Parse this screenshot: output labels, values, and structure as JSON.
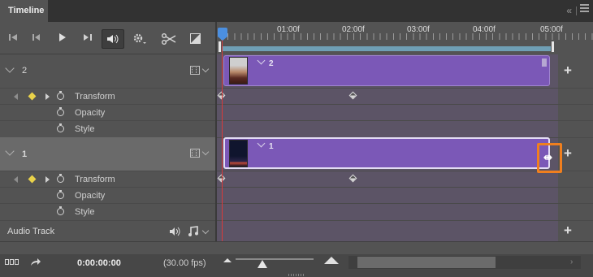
{
  "panel": {
    "tab_title": "Timeline",
    "collapse_glyph": "«",
    "menu_icon": "hamburger-menu-icon"
  },
  "transport": {
    "buttons": [
      "go-to-first-frame-icon",
      "previous-frame-icon",
      "play-icon",
      "next-frame-icon",
      "mute-audio-icon",
      "settings-icon",
      "split-at-playhead-icon",
      "transition-icon"
    ]
  },
  "ruler": {
    "labels": [
      "01:00f",
      "02:00f",
      "03:00f",
      "04:00f",
      "05:00f"
    ]
  },
  "tracks": [
    {
      "name": "2",
      "clip_name": "2",
      "properties": [
        "Transform",
        "Opacity",
        "Style"
      ],
      "selected": false
    },
    {
      "name": "1",
      "clip_name": "1",
      "properties": [
        "Transform",
        "Opacity",
        "Style"
      ],
      "selected": true
    }
  ],
  "audio": {
    "label": "Audio Track"
  },
  "status": {
    "timecode": "0:00:00:00",
    "fps": "(30.00 fps)"
  },
  "colors": {
    "clip": "#7b58b7",
    "playhead": "#d83b3b",
    "keyframe": "#e9d24a",
    "highlight": "#f07f1e",
    "workarea": "#6f9fb5"
  }
}
